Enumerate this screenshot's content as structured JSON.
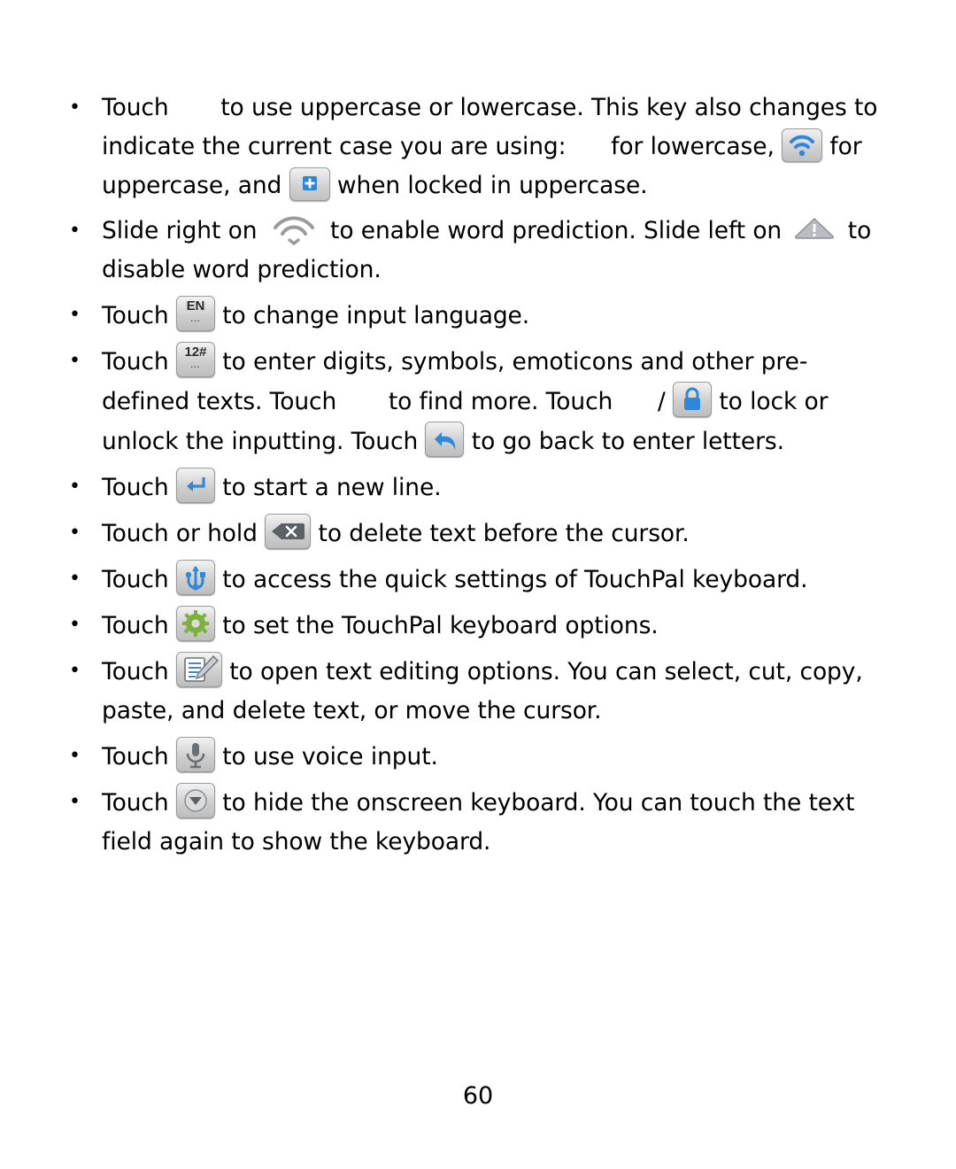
{
  "page": {
    "number": "60",
    "bullets": [
      {
        "id": "shift-key",
        "segments": [
          {
            "type": "text",
            "text": "Touch "
          },
          {
            "type": "icon",
            "name": "shift-key-icon",
            "glyph": "blank"
          },
          {
            "type": "text",
            "text": " to use uppercase or lowercase. This key also changes to indicate the current case you are using: "
          },
          {
            "type": "icon",
            "name": "lowercase-indicator-icon",
            "glyph": "blank-sm"
          },
          {
            "type": "text",
            "text": " for lowercase, "
          },
          {
            "type": "icon",
            "name": "uppercase-indicator-icon",
            "glyph": "wifi-blue"
          },
          {
            "type": "text",
            "text": " for uppercase, and "
          },
          {
            "type": "icon",
            "name": "caps-lock-indicator-icon",
            "glyph": "plus-blue"
          },
          {
            "type": "text",
            "text": " when locked in uppercase."
          }
        ]
      },
      {
        "id": "word-prediction",
        "segments": [
          {
            "type": "text",
            "text": "Slide right on "
          },
          {
            "type": "icon",
            "name": "word-prediction-enable-icon",
            "glyph": "arcs-gray"
          },
          {
            "type": "text",
            "text": " to enable word prediction. Slide left on "
          },
          {
            "type": "icon",
            "name": "word-prediction-disable-icon",
            "glyph": "triangle-gray"
          },
          {
            "type": "text",
            "text": " to disable word prediction."
          }
        ]
      },
      {
        "id": "input-language",
        "segments": [
          {
            "type": "text",
            "text": "Touch "
          },
          {
            "type": "icon",
            "name": "input-language-key-icon",
            "glyph": "key-en"
          },
          {
            "type": "text",
            "text": " to change input language."
          }
        ]
      },
      {
        "id": "symbols",
        "segments": [
          {
            "type": "text",
            "text": "Touch "
          },
          {
            "type": "icon",
            "name": "digits-symbols-key-icon",
            "glyph": "key-12"
          },
          {
            "type": "text",
            "text": " to enter digits, symbols, emoticons and other pre-defined texts. Touch "
          },
          {
            "type": "icon",
            "name": "find-more-key-icon",
            "glyph": "blank"
          },
          {
            "type": "text",
            "text": " to find more. Touch "
          },
          {
            "type": "icon",
            "name": "unlock-input-key-icon",
            "glyph": "blank-sm"
          },
          {
            "type": "text",
            "text": " / "
          },
          {
            "type": "icon",
            "name": "lock-input-key-icon",
            "glyph": "lock-blue"
          },
          {
            "type": "text",
            "text": " to lock or unlock the inputting. Touch "
          },
          {
            "type": "icon",
            "name": "back-to-letters-key-icon",
            "glyph": "back-arrow-blue"
          },
          {
            "type": "text",
            "text": " to go back to enter letters."
          }
        ]
      },
      {
        "id": "new-line",
        "segments": [
          {
            "type": "text",
            "text": "Touch "
          },
          {
            "type": "icon",
            "name": "enter-key-icon",
            "glyph": "enter-blue"
          },
          {
            "type": "text",
            "text": " to start a new line."
          }
        ]
      },
      {
        "id": "delete",
        "segments": [
          {
            "type": "text",
            "text": "Touch or hold "
          },
          {
            "type": "icon",
            "name": "backspace-key-icon",
            "glyph": "backspace"
          },
          {
            "type": "text",
            "text": " to delete text before the cursor."
          }
        ]
      },
      {
        "id": "quick-settings",
        "segments": [
          {
            "type": "text",
            "text": "Touch "
          },
          {
            "type": "icon",
            "name": "quick-settings-key-icon",
            "glyph": "usb-blue"
          },
          {
            "type": "text",
            "text": " to access the quick settings of TouchPal keyboard."
          }
        ]
      },
      {
        "id": "keyboard-options",
        "segments": [
          {
            "type": "text",
            "text": "Touch "
          },
          {
            "type": "icon",
            "name": "keyboard-options-key-icon",
            "glyph": "gear-green"
          },
          {
            "type": "text",
            "text": " to set the TouchPal keyboard options."
          }
        ]
      },
      {
        "id": "text-editing",
        "segments": [
          {
            "type": "text",
            "text": "Touch "
          },
          {
            "type": "icon",
            "name": "text-editing-key-icon",
            "glyph": "edit-doc"
          },
          {
            "type": "text",
            "text": " to open text editing options. You can select, cut, copy, paste, and delete text, or move the cursor."
          }
        ]
      },
      {
        "id": "voice-input",
        "segments": [
          {
            "type": "text",
            "text": "Touch "
          },
          {
            "type": "icon",
            "name": "voice-input-key-icon",
            "glyph": "mic"
          },
          {
            "type": "text",
            "text": " to use voice input."
          }
        ]
      },
      {
        "id": "hide-keyboard",
        "segments": [
          {
            "type": "text",
            "text": "Touch "
          },
          {
            "type": "icon",
            "name": "hide-keyboard-key-icon",
            "glyph": "chevron-down-circle"
          },
          {
            "type": "text",
            "text": " to hide the onscreen keyboard. You can touch the text field again to show the keyboard."
          }
        ]
      }
    ]
  },
  "colors": {
    "icon_blue": "#2f87d8",
    "icon_green": "#7bb23c",
    "key_gray": "#cfcfcf",
    "text": "#000000"
  }
}
